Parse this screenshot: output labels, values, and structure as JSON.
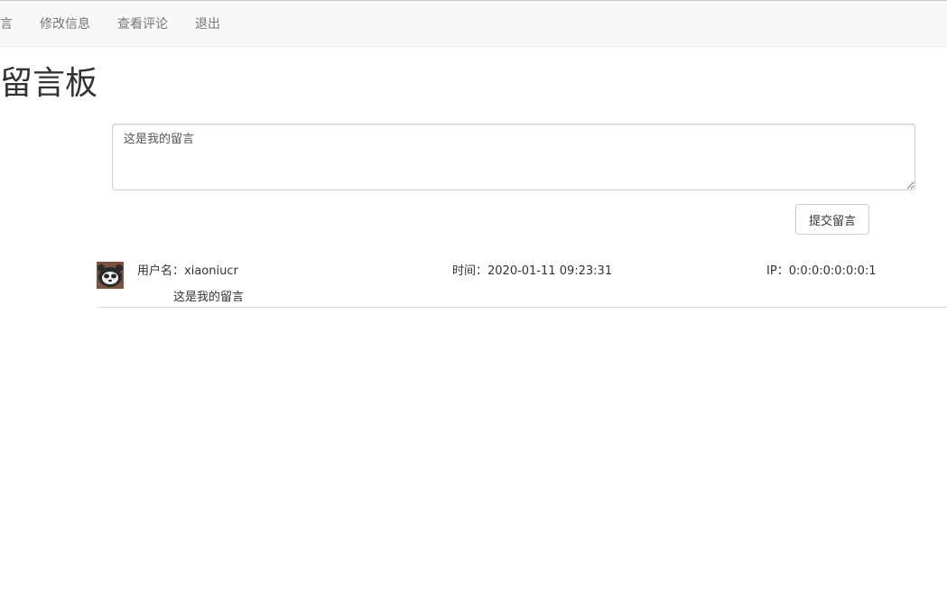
{
  "nav": {
    "partial_label": "留言",
    "edit_label": "修改信息",
    "comments_label": "查看评论",
    "logout_label": "退出"
  },
  "page": {
    "title": "留言板"
  },
  "form": {
    "textarea_value": "这是我的留言",
    "submit_label": "提交留言"
  },
  "comments": [
    {
      "user_label": "用户名：",
      "username": "xiaoniucr",
      "time_label": "时间：",
      "time": "2020-01-11 09:23:31",
      "ip_label": "IP：",
      "ip": "0:0:0:0:0:0:0:1",
      "content": "这是我的留言"
    }
  ],
  "colors": {
    "navbar_bg": "#f8f8f8",
    "nav_text": "#777777",
    "text": "#333333",
    "border": "#cccccc"
  }
}
